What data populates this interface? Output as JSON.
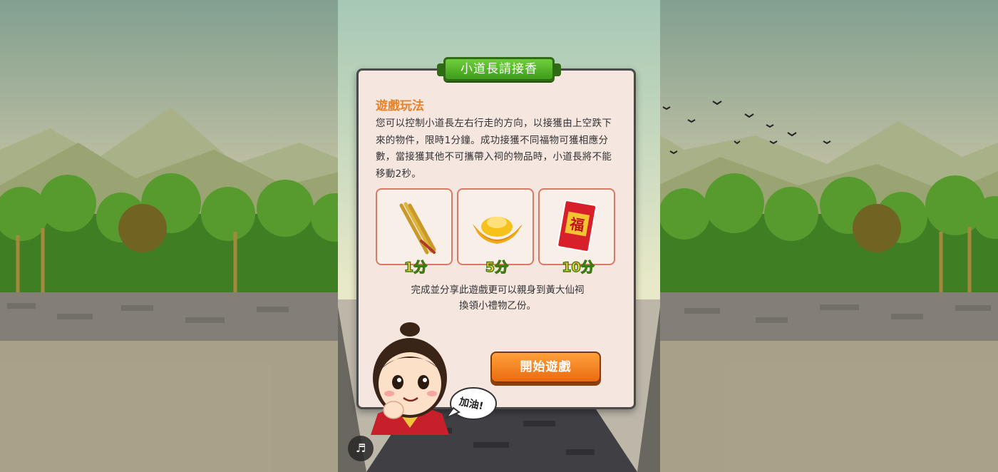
{
  "dialog": {
    "title": "小道長請接香",
    "rules_heading": "遊戲玩法",
    "rules_text": "您可以控制小道長左右行走的方向，以接獲由上空跌下來的物件，限時1分鐘。成功接獲不同福物可獲相應分數，當接獲其他不可攜帶入祠的物品時，小道長將不能移動2秒。",
    "items": [
      {
        "icon": "incense-sticks-icon",
        "score": "1分"
      },
      {
        "icon": "gold-ingot-icon",
        "score": "5分"
      },
      {
        "icon": "red-packet-fu-icon",
        "score": "10分",
        "glyph": "福"
      }
    ],
    "reward_line1": "完成並分享此遊戲更可以親身到黃大仙祠",
    "reward_line2": "換領小禮物乙份。",
    "start_button": "開始遊戲"
  },
  "character": {
    "speech": "加油!"
  },
  "controls": {
    "music_icon": "♬"
  },
  "colors": {
    "ribbon_green": "#4fae25",
    "heading_orange": "#e5832a",
    "button_orange": "#f27f1e",
    "card_border": "#d97a67",
    "score_yellow": "#ffd23c"
  }
}
